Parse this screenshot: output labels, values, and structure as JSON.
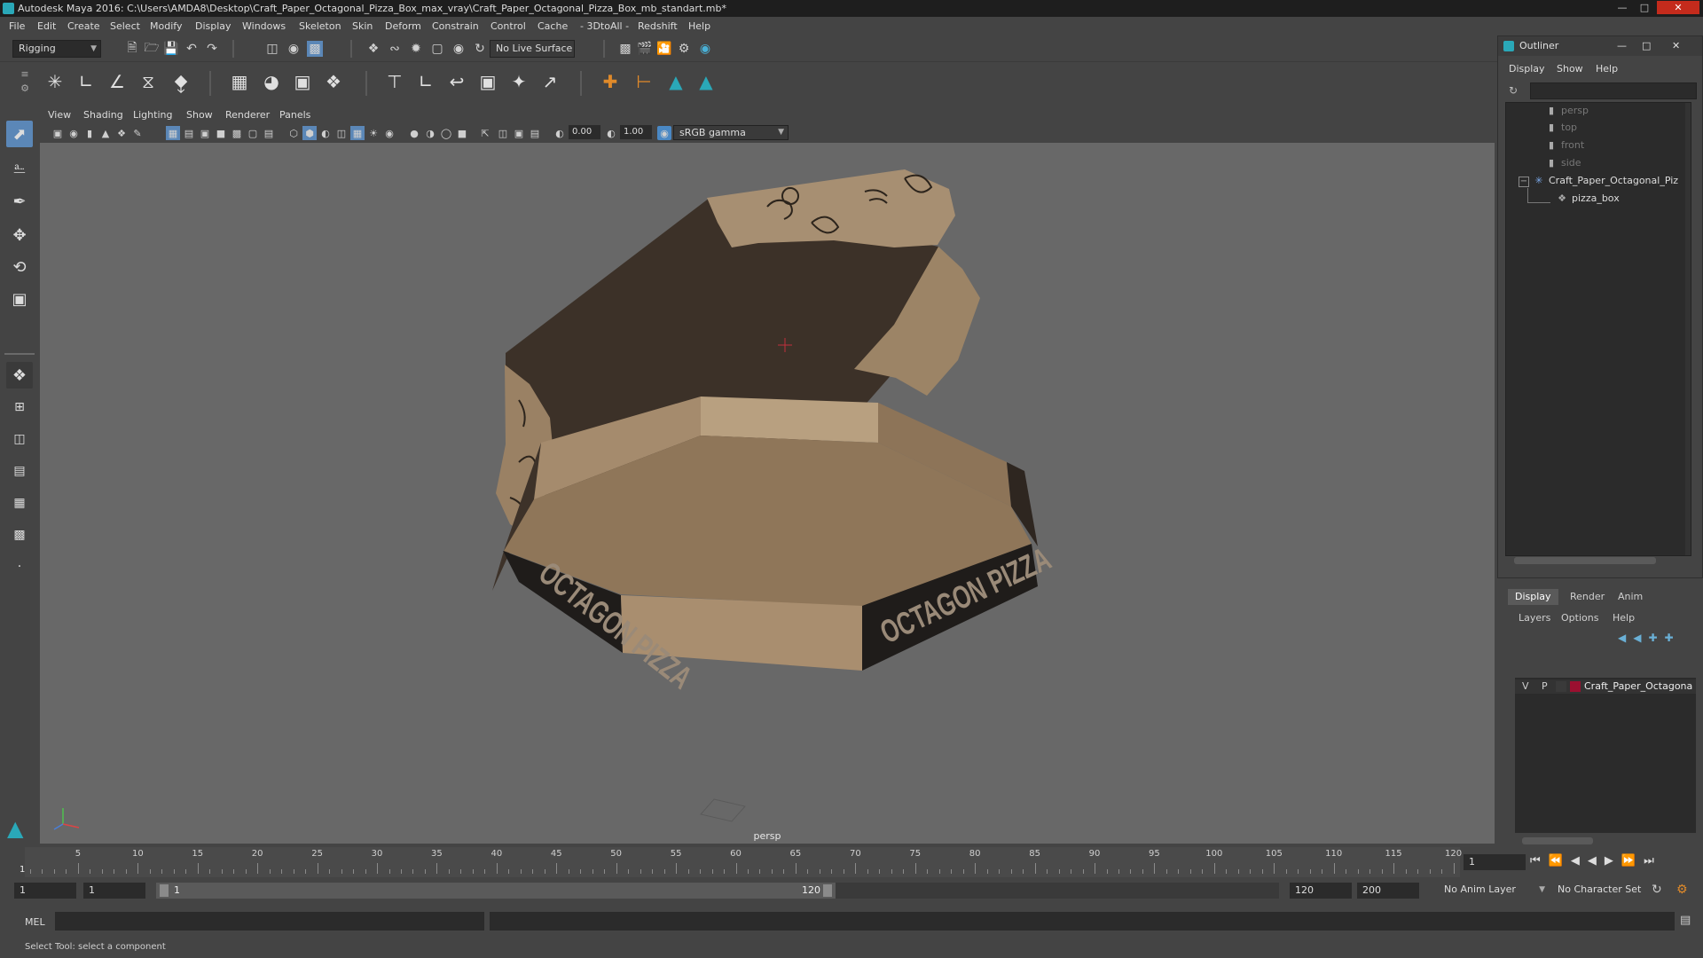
{
  "window": {
    "title": "Autodesk Maya 2016: C:\\Users\\AMDA8\\Desktop\\Craft_Paper_Octagonal_Pizza_Box_max_vray\\Craft_Paper_Octagonal_Pizza_Box_mb_standart.mb*"
  },
  "menubar": [
    "File",
    "Edit",
    "Create",
    "Select",
    "Modify",
    "Display",
    "Windows",
    "Skeleton",
    "Skin",
    "Deform",
    "Constrain",
    "Control",
    "Cache",
    "- 3DtoAll -",
    "Redshift",
    "Help"
  ],
  "statusline": {
    "menuset": "Rigging",
    "live_surface": "No Live Surface"
  },
  "viewport": {
    "menu": [
      "View",
      "Shading",
      "Lighting",
      "Show",
      "Renderer",
      "Panels"
    ],
    "exposure": "0.00",
    "gamma": "1.00",
    "color_space": "sRGB gamma",
    "camera": "persp",
    "box_text": "OCTAGON PIZZA"
  },
  "outliner": {
    "title": "Outliner",
    "menu": [
      "Display",
      "Show",
      "Help"
    ],
    "items": [
      {
        "label": "persp",
        "icon": "camera-icon",
        "dim": true
      },
      {
        "label": "top",
        "icon": "camera-icon",
        "dim": true
      },
      {
        "label": "front",
        "icon": "camera-icon",
        "dim": true
      },
      {
        "label": "side",
        "icon": "camera-icon",
        "dim": true
      },
      {
        "label": "Craft_Paper_Octagonal_Piz",
        "icon": "group-icon",
        "dim": false
      },
      {
        "label": "pizza_box",
        "icon": "mesh-icon",
        "dim": false
      }
    ]
  },
  "layers": {
    "tabs": [
      "Display",
      "Render",
      "Anim"
    ],
    "menu": [
      "Layers",
      "Options",
      "Help"
    ],
    "row": {
      "v": "V",
      "p": "P",
      "name": "Craft_Paper_Octagona",
      "color": "#9b1030"
    }
  },
  "timeslider": {
    "ticks": [
      "5",
      "10",
      "15",
      "20",
      "25",
      "30",
      "35",
      "40",
      "45",
      "50",
      "55",
      "60",
      "65",
      "70",
      "75",
      "80",
      "85",
      "90",
      "95",
      "100",
      "105",
      "110",
      "115",
      "120"
    ],
    "current_frame": "1",
    "start_marker": "1"
  },
  "rangeslider": {
    "start": "1",
    "playback_start": "1",
    "range_start_label": "1",
    "range_end_label": "120",
    "playback_end": "120",
    "end": "200",
    "anim_layer": "No Anim Layer",
    "char_set": "No Character Set"
  },
  "cmdline": {
    "lang": "MEL"
  },
  "helpline": {
    "text": "Select Tool: select a component"
  }
}
